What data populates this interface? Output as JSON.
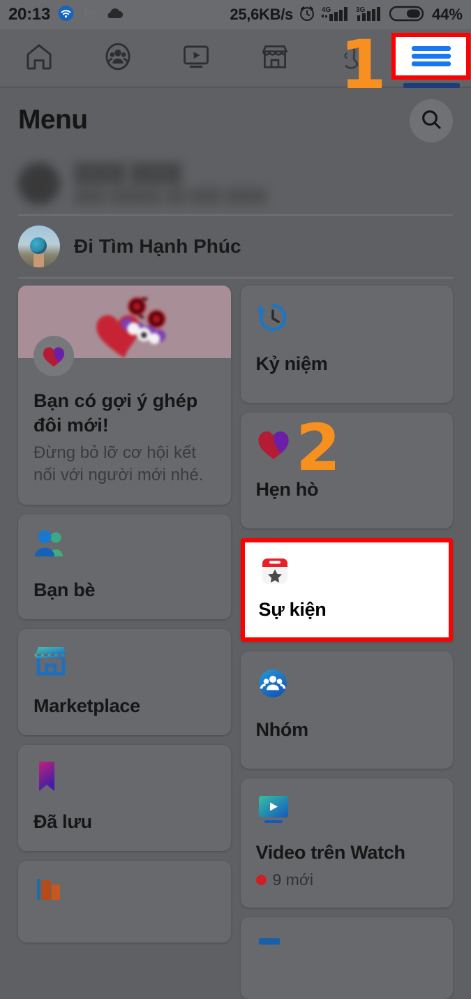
{
  "status_bar": {
    "time": "20:13",
    "network_speed": "25,6KB/s",
    "battery_percent": "44%",
    "icons": [
      "wifi-icon",
      "hotspot-icon",
      "cloud-icon",
      "alarm-icon",
      "signal-4g-icon",
      "signal-3g-icon",
      "battery-icon"
    ],
    "signal_labels": {
      "sim1": "4G",
      "sim2": "3G"
    }
  },
  "top_nav": {
    "items": [
      {
        "name": "home",
        "icon": "home-icon",
        "active": false
      },
      {
        "name": "friends",
        "icon": "friends-icon",
        "active": false
      },
      {
        "name": "watch",
        "icon": "video-play-icon",
        "active": false
      },
      {
        "name": "marketplace",
        "icon": "store-icon",
        "active": false
      },
      {
        "name": "profile",
        "icon": "profile-avatar-icon",
        "active": false
      },
      {
        "name": "menu",
        "icon": "hamburger-menu-icon",
        "active": true
      }
    ]
  },
  "annotations": [
    {
      "label": "1",
      "target": "hamburger-menu-icon",
      "color": "#F7901E"
    },
    {
      "label": "2",
      "target": "su-kien-card",
      "color": "#F7901E"
    }
  ],
  "highlights": {
    "color": "#FF0000",
    "targets": [
      "hamburger-menu-button",
      "su-kien-card"
    ]
  },
  "menu_header": {
    "title": "Menu",
    "search_icon": "search-icon"
  },
  "profile_rows": [
    {
      "name": "",
      "subtitle": "",
      "blurred": true,
      "avatar": "user-avatar"
    },
    {
      "name": "Đi Tìm Hạnh Phúc",
      "subtitle": "",
      "blurred": false,
      "avatar": "page-avatar"
    }
  ],
  "shortcuts": {
    "left_column": [
      {
        "id": "ghep-doi-card",
        "type": "suggestion",
        "icon": "dating-heart-icon",
        "title": "Bạn có gợi ý ghép đôi mới!",
        "subtitle": "Đừng bỏ lỡ cơ hội kết nối với người mới nhé.",
        "image": "heart-with-roses-image",
        "highlighted": false
      },
      {
        "id": "ban-be-card",
        "type": "tile",
        "icon": "friends-icon",
        "label": "Bạn bè",
        "highlighted": false
      },
      {
        "id": "marketplace-card",
        "type": "tile",
        "icon": "store-icon",
        "label": "Marketplace",
        "highlighted": false
      },
      {
        "id": "da-luu-card",
        "type": "tile",
        "icon": "bookmark-icon",
        "label": "Đã lưu",
        "highlighted": false
      },
      {
        "id": "partial-card-left",
        "type": "partial",
        "icon": "pages-folder-icon",
        "label": "",
        "highlighted": false
      }
    ],
    "right_column": [
      {
        "id": "ky-niem-card",
        "type": "tile",
        "icon": "clock-rewind-icon",
        "label": "Kỷ niệm",
        "highlighted": false
      },
      {
        "id": "hen-ho-card",
        "type": "tile",
        "icon": "dating-heart-icon",
        "label": "Hẹn hò",
        "highlighted": false
      },
      {
        "id": "su-kien-card",
        "type": "tile",
        "icon": "calendar-star-icon",
        "label": "Sự kiện",
        "highlighted": true
      },
      {
        "id": "nhom-card",
        "type": "tile",
        "icon": "groups-icon",
        "label": "Nhóm",
        "highlighted": false
      },
      {
        "id": "video-watch-card",
        "type": "tile",
        "icon": "watch-video-icon",
        "label": "Video trên Watch",
        "badge": "9 mới",
        "badge_dot_color": "#CC2026",
        "highlighted": false
      },
      {
        "id": "partial-card-right",
        "type": "partial",
        "icon": "feed-icon",
        "label": "",
        "highlighted": false
      }
    ]
  },
  "theme": {
    "background": "#5e6063",
    "card_background": "#67696c",
    "accent_blue": "#1877F2",
    "highlight_red": "#FF0000",
    "annotation_orange": "#F7901E",
    "active_tab_indicator": "#1D3E7A"
  }
}
